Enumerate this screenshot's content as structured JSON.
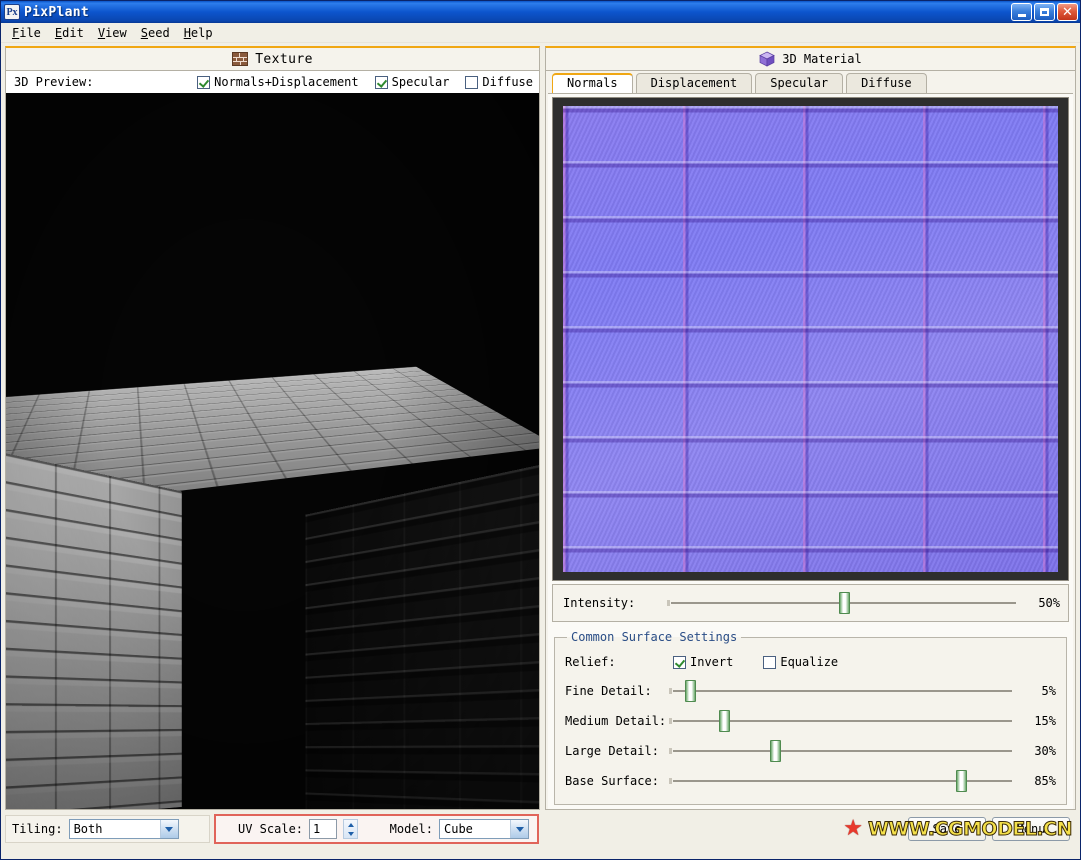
{
  "window": {
    "title": "PixPlant",
    "icon": "app-icon-px",
    "controls": {
      "minimize": "minimize",
      "maximize": "maximize",
      "close": "close"
    }
  },
  "menu": [
    {
      "label": "File",
      "mnemonic": "F",
      "rest": "ile"
    },
    {
      "label": "Edit",
      "mnemonic": "E",
      "rest": "dit"
    },
    {
      "label": "View",
      "mnemonic": "V",
      "rest": "iew"
    },
    {
      "label": "Seed",
      "mnemonic": "S",
      "rest": "eed"
    },
    {
      "label": "Help",
      "mnemonic": "H",
      "rest": "elp"
    }
  ],
  "texture_panel": {
    "title": "Texture",
    "icon": "brick-icon",
    "preview_label": "3D Preview:",
    "options": [
      {
        "label": "Normals+Displacement",
        "checked": true
      },
      {
        "label": "Specular",
        "checked": true
      },
      {
        "label": "Diffuse",
        "checked": false
      }
    ],
    "viewport": {
      "model": "cube",
      "render": "grayscale brick normal+specular shaded cube"
    }
  },
  "material_panel": {
    "title": "3D Material",
    "icon": "cube-icon",
    "tabs": [
      {
        "label": "Normals",
        "active": true
      },
      {
        "label": "Displacement",
        "active": false
      },
      {
        "label": "Specular",
        "active": false
      },
      {
        "label": "Diffuse",
        "active": false
      }
    ],
    "map_preview": "normal map of brick wall",
    "intensity": {
      "label": "Intensity:",
      "value": "50%",
      "percent": 50
    },
    "surface_group": {
      "legend": "Common Surface Settings",
      "relief": {
        "label": "Relief:",
        "options": [
          {
            "label": "Invert",
            "checked": true
          },
          {
            "label": "Equalize",
            "checked": false
          }
        ]
      },
      "sliders": [
        {
          "label": "Fine Detail:",
          "value": "5%",
          "percent": 5
        },
        {
          "label": "Medium Detail:",
          "value": "15%",
          "percent": 15
        },
        {
          "label": "Large Detail:",
          "value": "30%",
          "percent": 30
        },
        {
          "label": "Base Surface:",
          "value": "85%",
          "percent": 85
        }
      ]
    }
  },
  "bottom_bar": {
    "tiling": {
      "label": "Tiling:",
      "value": "Both"
    },
    "uv_scale": {
      "label": "UV Scale:",
      "value": "1"
    },
    "model": {
      "label": "Model:",
      "value": "Cube"
    },
    "buttons": [
      {
        "label": "Save"
      },
      {
        "label": "Menu"
      }
    ],
    "watermark": {
      "star": "★",
      "text": "WWW.CGMODEL.CN"
    }
  },
  "colors": {
    "accent_orange": "#f0a713",
    "highlight_red": "#e0645a",
    "titlebar_blue": "#0c55cd",
    "slider_green": "#6aa86a",
    "legend_blue": "#2a4d86"
  }
}
